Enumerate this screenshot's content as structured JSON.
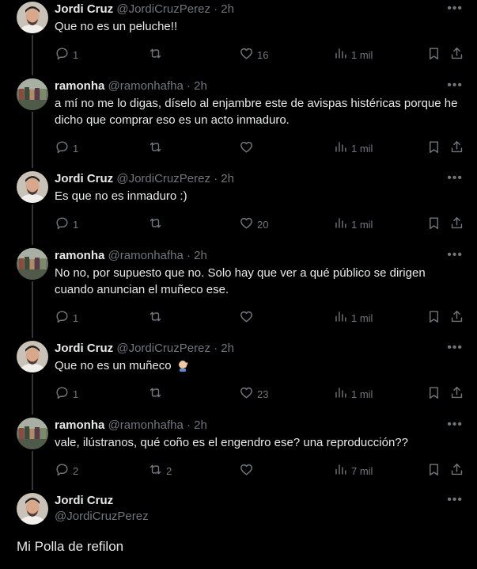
{
  "tweets": [
    {
      "name": "Jordi Cruz",
      "handle": "@JordiCruzPerez",
      "time": "2h",
      "text": "Que no es un peluche!!",
      "emoji": "",
      "replies": "1",
      "retweets": "",
      "likes": "16",
      "views": "1 mil",
      "avatar": "jordi"
    },
    {
      "name": "ramonha",
      "handle": "@ramonhafha",
      "time": "2h",
      "text": "a mí no me lo digas, díselo al enjambre este de avispas histéricas porque he dicho que comprar eso es un acto inmaduro.",
      "emoji": "",
      "replies": "1",
      "retweets": "",
      "likes": "",
      "views": "1 mil",
      "avatar": "ramon"
    },
    {
      "name": "Jordi Cruz",
      "handle": "@JordiCruzPerez",
      "time": "2h",
      "text": "Es que no es inmaduro :)",
      "emoji": "",
      "replies": "1",
      "retweets": "",
      "likes": "20",
      "views": "1 mil",
      "avatar": "jordi"
    },
    {
      "name": "ramonha",
      "handle": "@ramonhafha",
      "time": "2h",
      "text": "No no, por supuesto que no. Solo hay que ver a qué público se dirigen cuando anuncian el muñeco ese.",
      "emoji": "",
      "replies": "1",
      "retweets": "",
      "likes": "",
      "views": "1 mil",
      "avatar": "ramon"
    },
    {
      "name": "Jordi Cruz",
      "handle": "@JordiCruzPerez",
      "time": "2h",
      "text": "Que no es un muñeco",
      "emoji": "man-facepalming",
      "replies": "1",
      "retweets": "",
      "likes": "23",
      "views": "1 mil",
      "avatar": "jordi"
    },
    {
      "name": "ramonha",
      "handle": "@ramonhafha",
      "time": "2h",
      "text": "vale, ilústranos, qué coño es el engendro ese? una reproducción??",
      "emoji": "",
      "replies": "2",
      "retweets": "2",
      "likes": "",
      "views": "7 mil",
      "avatar": "ramon"
    }
  ],
  "main_tweet": {
    "name": "Jordi Cruz",
    "handle": "@JordiCruzPerez",
    "text": "Mi Polla de refilon"
  },
  "icons": {
    "reply": "reply-icon",
    "retweet": "retweet-icon",
    "like": "heart-icon",
    "views": "views-icon",
    "bookmark": "bookmark-icon",
    "share": "share-icon",
    "more": "more-icon"
  },
  "colors": {
    "background": "#000000",
    "text": "#e7e9ea",
    "muted": "#71767b",
    "thread_line": "#333639"
  }
}
